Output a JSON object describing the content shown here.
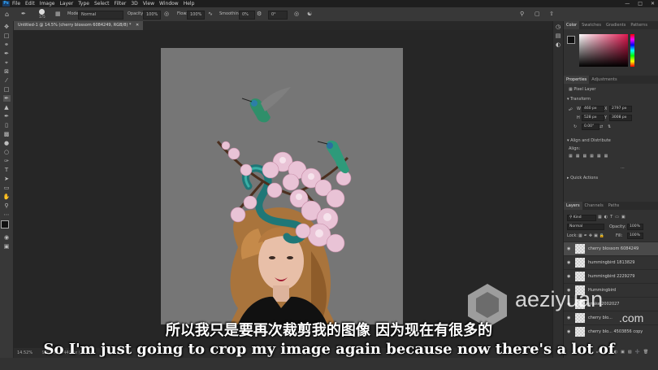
{
  "app": {
    "logo": "Ps"
  },
  "menubar": {
    "items": [
      "File",
      "Edit",
      "Image",
      "Layer",
      "Type",
      "Select",
      "Filter",
      "3D",
      "View",
      "Window",
      "Help"
    ]
  },
  "options": {
    "mode_label": "Mode:",
    "mode_value": "Normal",
    "opacity_label": "Opacity:",
    "opacity_value": "100%",
    "flow_label": "Flow:",
    "flow_value": "100%",
    "smoothing_label": "Smoothing:",
    "smoothing_value": "0%",
    "angle_value": "0°",
    "brush_size": "175"
  },
  "document": {
    "tab_title": "Untitled-1 @ 14.5% (cherry blossom 6084249, RGB/8) *"
  },
  "status": {
    "zoom": "14.52%",
    "doc_info": "960 Px x 1440 Px (72 ppi)"
  },
  "color_panel": {
    "tabs": [
      "Color",
      "Swatches",
      "Gradients",
      "Patterns"
    ]
  },
  "properties_panel": {
    "tabs": [
      "Properties",
      "Adjustments"
    ],
    "layer_type": "Pixel Layer",
    "transform_header": "Transform",
    "w_label": "W",
    "w_value": "460 px",
    "x_label": "X",
    "x_value": "2797 px",
    "h_label": "H",
    "h_value": "528 px",
    "y_label": "Y",
    "y_value": "3008 px",
    "angle_value": "0.00°",
    "align_header": "Align and Distribute",
    "align_label": "Align:",
    "quick_actions_header": "Quick Actions"
  },
  "layers_panel": {
    "tabs": [
      "Layers",
      "Channels",
      "Paths"
    ],
    "filter_kind": "Kind",
    "blend_mode": "Normal",
    "opacity_label": "Opacity:",
    "opacity_value": "100%",
    "lock_label": "Lock:",
    "fill_label": "Fill:",
    "fill_value": "100%",
    "layers": [
      {
        "name": "cherry blossom 6084249",
        "selected": true
      },
      {
        "name": "hummingbird 1813829",
        "selected": false
      },
      {
        "name": "hummingbird 2229279",
        "selected": false
      },
      {
        "name": "Hummingbird",
        "selected": false
      },
      {
        "name": "snake 2002027",
        "selected": false
      },
      {
        "name": "cherry blo...",
        "selected": false
      },
      {
        "name": "cherry blo... 4503856 copy",
        "selected": false
      }
    ]
  },
  "subtitles": {
    "chinese": "所以我只是要再次裁剪我的图像 因为现在有很多的",
    "english": "So I'm just going to crop my image again because now there's a lot of"
  },
  "watermark": {
    "text": "aeziyuan",
    "domain": ".com"
  },
  "colors": {
    "accent": "#31a8ff",
    "app_bg": "#323232",
    "canvas_bg": "#262626",
    "artboard": "#767676"
  }
}
